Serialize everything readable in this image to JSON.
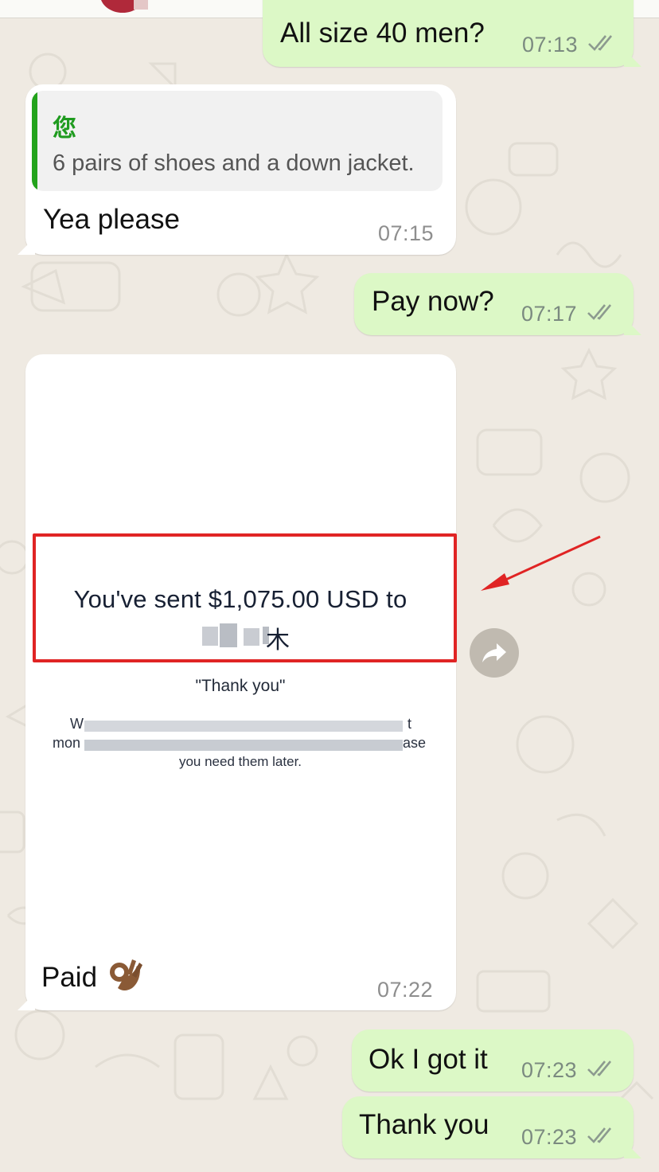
{
  "header": {
    "avatar_icon": "avatar-icon"
  },
  "messages": [
    {
      "id": "m1",
      "direction": "outgoing",
      "text": "All size 40 men?",
      "time": "07:13",
      "status": "read"
    },
    {
      "id": "m2",
      "direction": "incoming",
      "reply_to": {
        "author": "您",
        "text": "6 pairs of shoes and a down jacket."
      },
      "text": "Yea please",
      "time": "07:15"
    },
    {
      "id": "m3",
      "direction": "outgoing",
      "text": "Pay now?",
      "time": "07:17",
      "status": "read"
    },
    {
      "id": "m4",
      "direction": "incoming",
      "type": "image",
      "image": {
        "sent_line": "You've sent $1,075.00 USD to",
        "recipient_visible": "木",
        "note": "\"Thank you\"",
        "detail_start_1": "W",
        "detail_start_2": "mon",
        "detail_end_1": "t",
        "detail_end_2": "ase",
        "detail_last_line": "you need them later."
      },
      "caption": "Paid",
      "caption_emoji": "ok-hand-emoji",
      "time": "07:22"
    },
    {
      "id": "m5",
      "direction": "outgoing",
      "text": "Ok I got it",
      "time": "07:23",
      "status": "read"
    },
    {
      "id": "m6",
      "direction": "outgoing",
      "text": "Thank you",
      "time": "07:23",
      "status": "read"
    }
  ],
  "annotation": {
    "highlight_color": "#e02424",
    "arrow_color": "#e02424"
  },
  "colors": {
    "outgoing_bubble": "#dcf8c6",
    "incoming_bubble": "#ffffff",
    "background": "#efeae2",
    "quote_author": "#1f9b1f"
  },
  "icons": {
    "forward": "forward-icon",
    "read_receipt": "double-check-icon"
  }
}
